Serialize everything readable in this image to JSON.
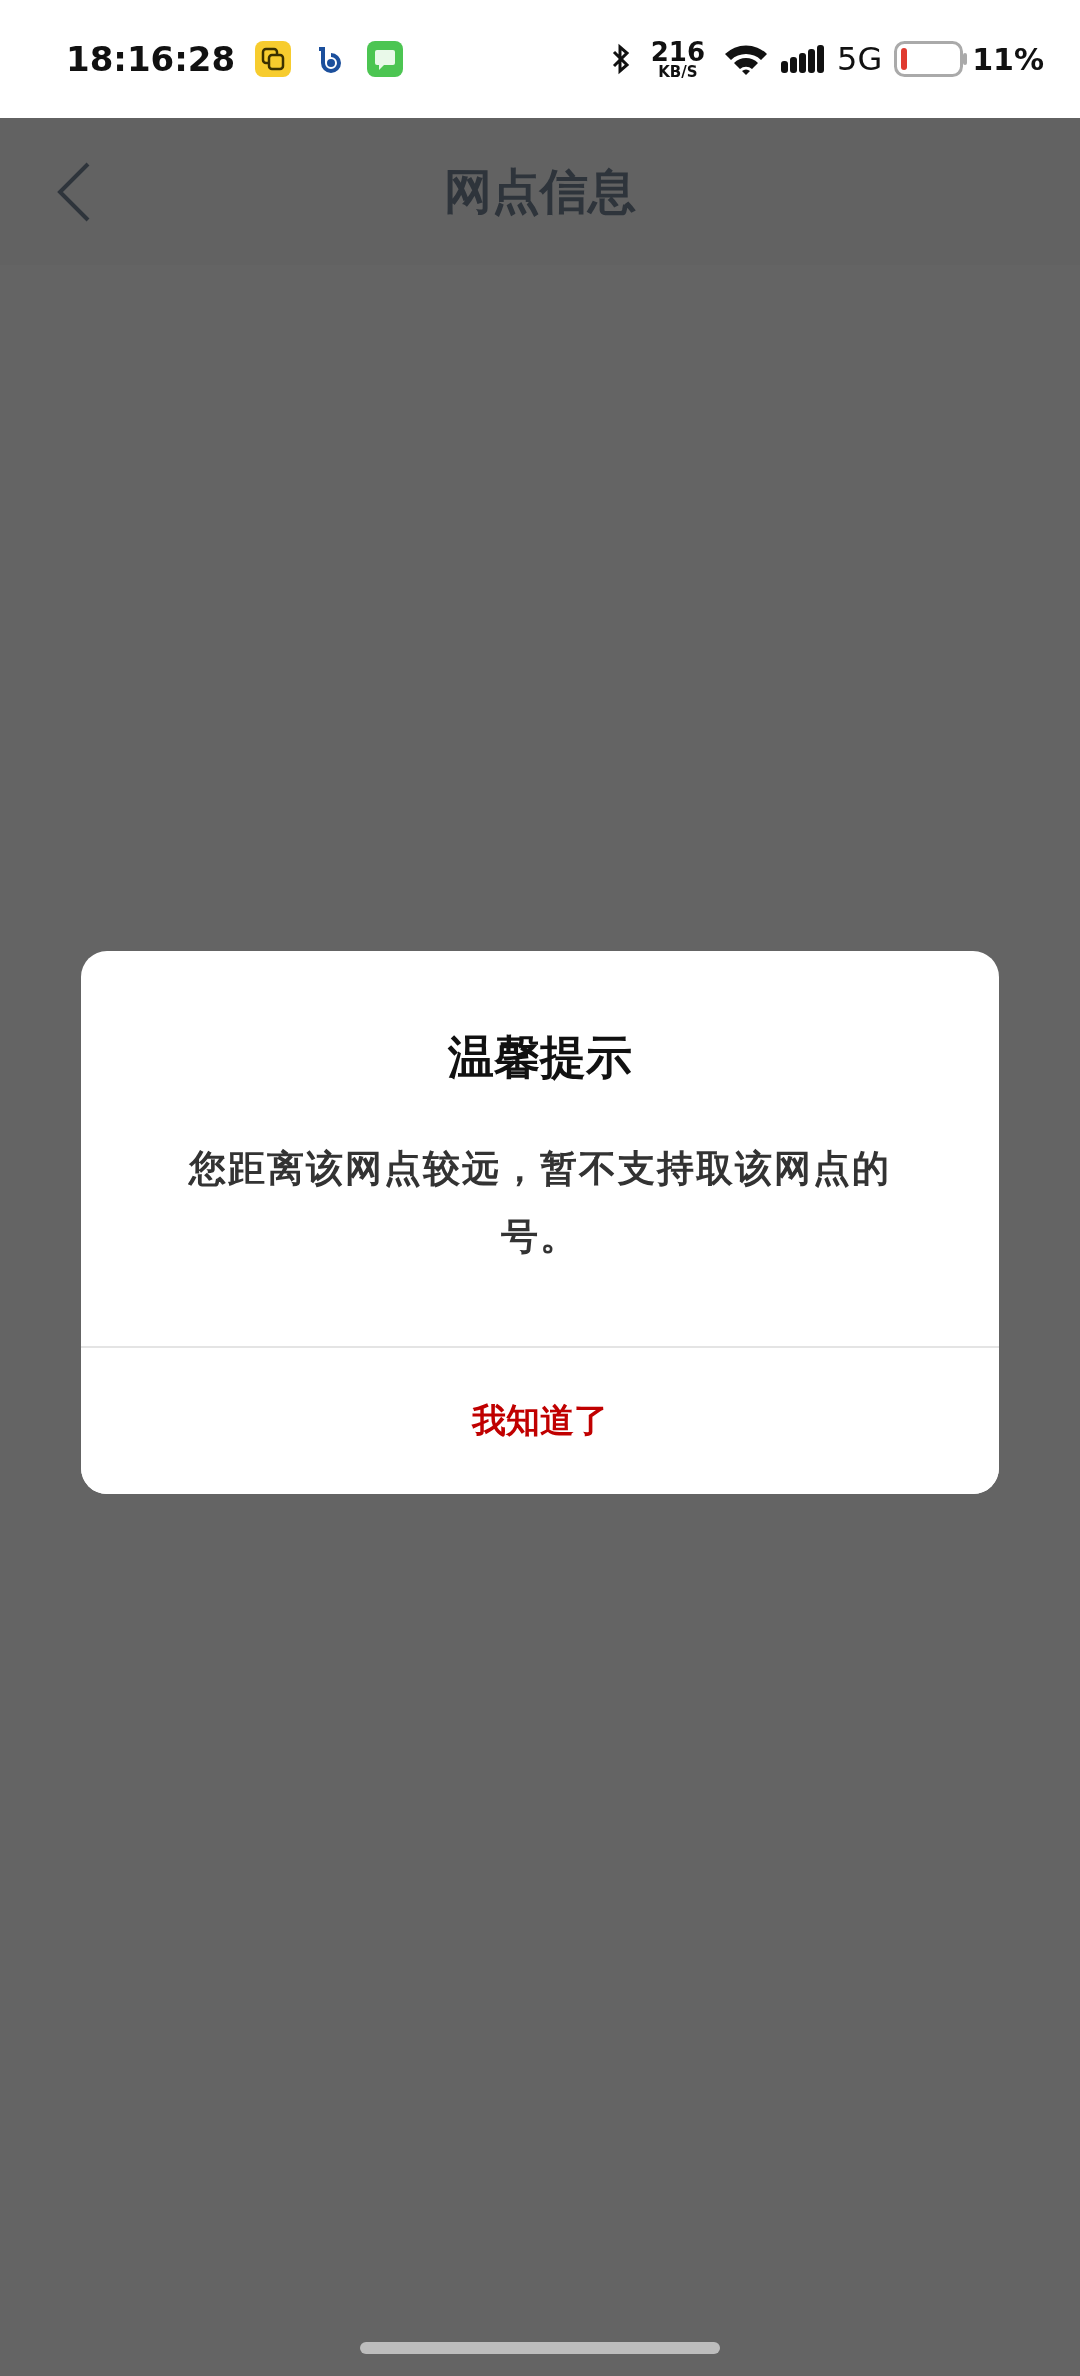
{
  "status_bar": {
    "time": "18:16:28",
    "net_speed": "216",
    "net_unit": "KB/S",
    "network": "5G",
    "battery": "11%"
  },
  "header": {
    "title": "网点信息"
  },
  "dialog": {
    "title": "温馨提示",
    "message": "您距离该网点较远，暂不支持取该网点的号。",
    "button": "我知道了"
  }
}
